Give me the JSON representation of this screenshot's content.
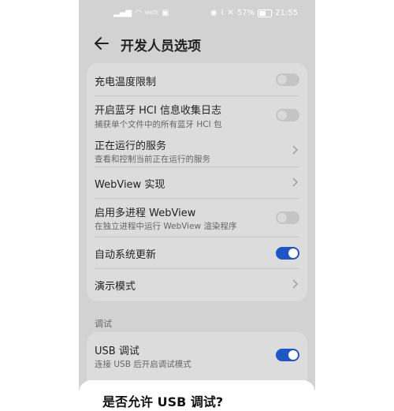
{
  "status_bar": {
    "carrier_text": "VoLTE",
    "battery_percent": "57%",
    "time": "21:55"
  },
  "header": {
    "title": "开发人员选项"
  },
  "settings": {
    "rows": [
      {
        "title": "充电温度限制",
        "subtitle": "",
        "control": "toggle",
        "on": false
      },
      {
        "title": "开启蓝牙 HCI 信息收集日志",
        "subtitle": "捕获单个文件中的所有蓝牙 HCI 包",
        "control": "toggle",
        "on": false
      },
      {
        "title": "正在运行的服务",
        "subtitle": "查看和控制当前正在运行的服务",
        "control": "chevron"
      },
      {
        "title": "WebView 实现",
        "subtitle": "",
        "control": "chevron"
      },
      {
        "title": "启用多进程 WebView",
        "subtitle": "在独立进程中运行 WebView 渲染程序",
        "control": "toggle",
        "on": false
      },
      {
        "title": "自动系统更新",
        "subtitle": "",
        "control": "toggle",
        "on": true
      },
      {
        "title": "演示模式",
        "subtitle": "",
        "control": "chevron"
      }
    ]
  },
  "debug_section": {
    "label": "调试",
    "usb_debug": {
      "title": "USB 调试",
      "subtitle": "连接 USB 后开启调试模式",
      "on": true
    }
  },
  "dialog": {
    "title": "是否允许 USB 调试?"
  },
  "colors": {
    "accent": "#1d56c7",
    "background": "#d2d2d2",
    "card": "#dcdcdc"
  }
}
